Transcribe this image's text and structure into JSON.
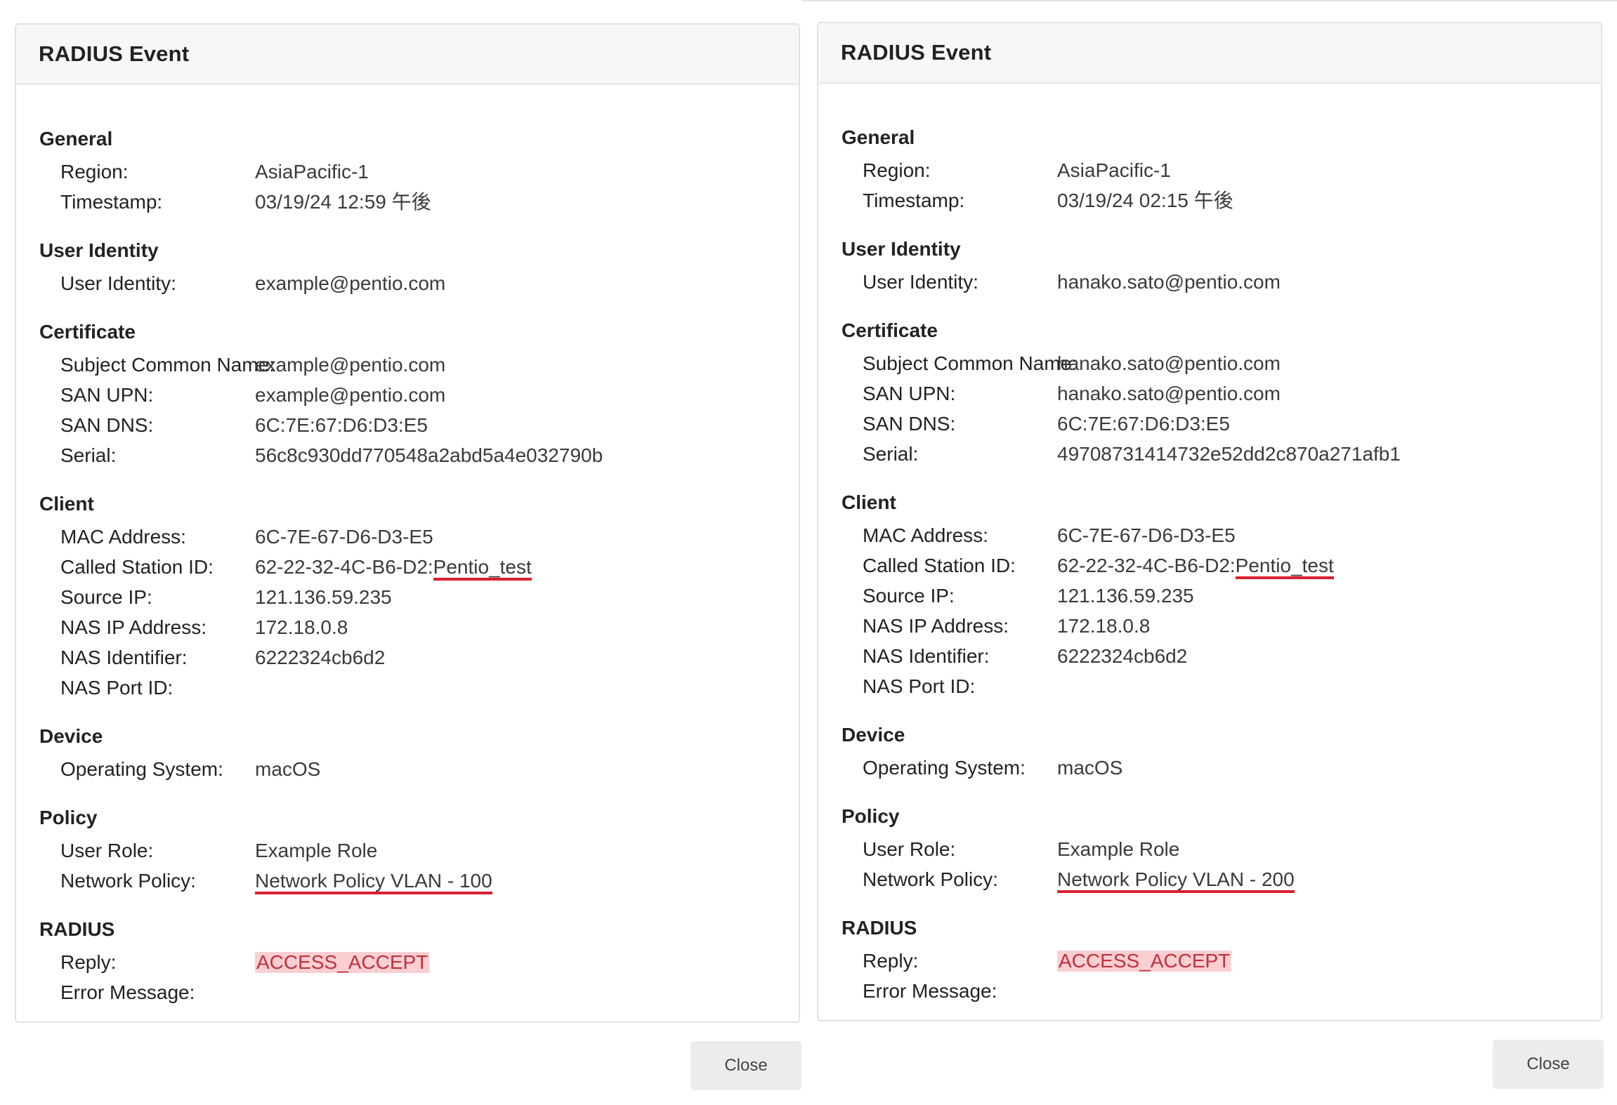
{
  "dialogs": [
    {
      "title": "RADIUS Event",
      "close_label": "Close",
      "general": {
        "heading": "General",
        "region_label": "Region:",
        "region": "AsiaPacific-1",
        "timestamp_label": "Timestamp:",
        "timestamp": "03/19/24 12:59 午後"
      },
      "user_identity": {
        "heading": "User Identity",
        "label": "User Identity:",
        "value": "example@pentio.com"
      },
      "certificate": {
        "heading": "Certificate",
        "subject_cn_label": "Subject Common Name:",
        "subject_cn": "example@pentio.com",
        "san_upn_label": "SAN UPN:",
        "san_upn": "example@pentio.com",
        "san_dns_label": "SAN DNS:",
        "san_dns": "6C:7E:67:D6:D3:E5",
        "serial_label": "Serial:",
        "serial": "56c8c930dd770548a2abd5a4e032790b"
      },
      "client": {
        "heading": "Client",
        "mac_label": "MAC Address:",
        "mac": "6C-7E-67-D6-D3-E5",
        "called_station_label": "Called Station ID:",
        "called_station_prefix": "62-22-32-4C-B6-D2:",
        "called_station_ssid": "Pentio_test",
        "source_ip_label": "Source IP:",
        "source_ip": "121.136.59.235",
        "nas_ip_label": "NAS IP Address:",
        "nas_ip": "172.18.0.8",
        "nas_identifier_label": "NAS Identifier:",
        "nas_identifier": "6222324cb6d2",
        "nas_port_label": "NAS Port ID:",
        "nas_port": ""
      },
      "device": {
        "heading": "Device",
        "os_label": "Operating System:",
        "os": "macOS"
      },
      "policy": {
        "heading": "Policy",
        "user_role_label": "User Role:",
        "user_role": "Example Role",
        "network_policy_label": "Network Policy:",
        "network_policy": "Network Policy VLAN - 100"
      },
      "radius": {
        "heading": "RADIUS",
        "reply_label": "Reply:",
        "reply": "ACCESS_ACCEPT",
        "error_label": "Error Message:",
        "error": ""
      }
    },
    {
      "title": "RADIUS Event",
      "close_label": "Close",
      "general": {
        "heading": "General",
        "region_label": "Region:",
        "region": "AsiaPacific-1",
        "timestamp_label": "Timestamp:",
        "timestamp": "03/19/24 02:15 午後"
      },
      "user_identity": {
        "heading": "User Identity",
        "label": "User Identity:",
        "value": "hanako.sato@pentio.com"
      },
      "certificate": {
        "heading": "Certificate",
        "subject_cn_label": "Subject Common Name:",
        "subject_cn": "hanako.sato@pentio.com",
        "san_upn_label": "SAN UPN:",
        "san_upn": "hanako.sato@pentio.com",
        "san_dns_label": "SAN DNS:",
        "san_dns": "6C:7E:67:D6:D3:E5",
        "serial_label": "Serial:",
        "serial": "49708731414732e52dd2c870a271afb1"
      },
      "client": {
        "heading": "Client",
        "mac_label": "MAC Address:",
        "mac": "6C-7E-67-D6-D3-E5",
        "called_station_label": "Called Station ID:",
        "called_station_prefix": "62-22-32-4C-B6-D2:",
        "called_station_ssid": "Pentio_test",
        "source_ip_label": "Source IP:",
        "source_ip": "121.136.59.235",
        "nas_ip_label": "NAS IP Address:",
        "nas_ip": "172.18.0.8",
        "nas_identifier_label": "NAS Identifier:",
        "nas_identifier": "6222324cb6d2",
        "nas_port_label": "NAS Port ID:",
        "nas_port": ""
      },
      "device": {
        "heading": "Device",
        "os_label": "Operating System:",
        "os": "macOS"
      },
      "policy": {
        "heading": "Policy",
        "user_role_label": "User Role:",
        "user_role": "Example Role",
        "network_policy_label": "Network Policy:",
        "network_policy": "Network Policy VLAN - 200"
      },
      "radius": {
        "heading": "RADIUS",
        "reply_label": "Reply:",
        "reply": "ACCESS_ACCEPT",
        "error_label": "Error Message:",
        "error": ""
      }
    }
  ],
  "colors": {
    "annotation_underline": "#d92030",
    "reply_highlight_bg": "#f9cfd2",
    "reply_highlight_text": "#c0303a",
    "header_bg": "#f7f7f7",
    "close_button_bg": "#ececec"
  }
}
